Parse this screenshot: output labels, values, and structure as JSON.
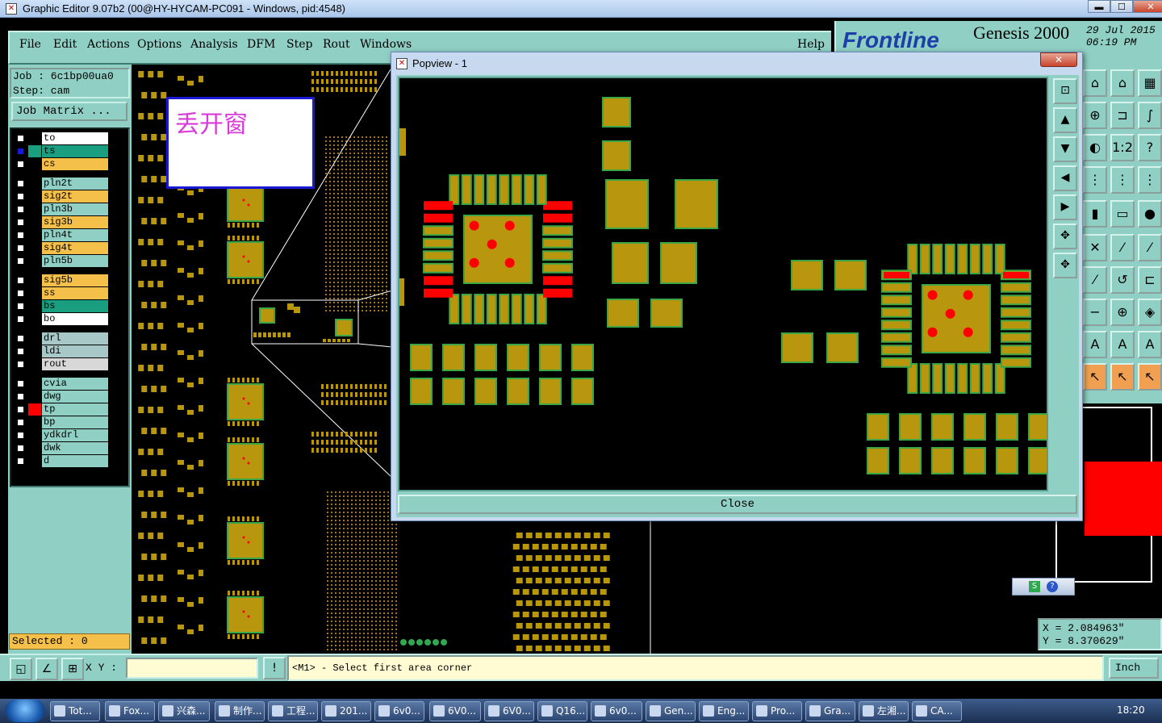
{
  "window": {
    "title": "Graphic Editor 9.07b2 (00@HY-HYCAM-PC091 - Windows, pid:4548)",
    "min": "▬",
    "max": "☐",
    "close": "✕"
  },
  "menu": {
    "items": [
      "File",
      "Edit",
      "Actions",
      "Options",
      "Analysis",
      "DFM",
      "Step",
      "Rout",
      "Windows"
    ],
    "help": "Help"
  },
  "brand": {
    "logo": "Frontline",
    "product": "Genesis 2000",
    "date": "29 Jul 2015",
    "time": "06:19 PM"
  },
  "job": {
    "job_line": "Job : 6c1bp00ua0",
    "step_line": "Step: cam",
    "matrix_button": "Job Matrix ..."
  },
  "layers": [
    {
      "name": "to",
      "color": "#ffffff",
      "swatch": "#000000",
      "checked": false
    },
    {
      "name": "ts",
      "color": "#1a9e80",
      "swatch": "#1a9e80",
      "checked": true
    },
    {
      "name": "cs",
      "color": "#f4c04a",
      "swatch": "#000000",
      "checked": false
    },
    {
      "name": "pln2t",
      "color": "#8fcfc4",
      "swatch": "#000000",
      "checked": false
    },
    {
      "name": "sig2t",
      "color": "#f4c04a",
      "swatch": "#000000",
      "checked": false
    },
    {
      "name": "pln3b",
      "color": "#8fcfc4",
      "swatch": "#000000",
      "checked": false
    },
    {
      "name": "sig3b",
      "color": "#f4c04a",
      "swatch": "#000000",
      "checked": false
    },
    {
      "name": "pln4t",
      "color": "#8fcfc4",
      "swatch": "#000000",
      "checked": false
    },
    {
      "name": "sig4t",
      "color": "#f4c04a",
      "swatch": "#000000",
      "checked": false
    },
    {
      "name": "pln5b",
      "color": "#8fcfc4",
      "swatch": "#000000",
      "checked": false
    },
    {
      "name": "sig5b",
      "color": "#f4c04a",
      "swatch": "#000000",
      "checked": false
    },
    {
      "name": "ss",
      "color": "#f4c04a",
      "swatch": "#000000",
      "checked": false
    },
    {
      "name": "bs",
      "color": "#1a9e80",
      "swatch": "#000000",
      "checked": false
    },
    {
      "name": "bo",
      "color": "#ffffff",
      "swatch": "#000000",
      "checked": false
    },
    {
      "name": "drl",
      "color": "#a8c8c8",
      "swatch": "#000000",
      "checked": false
    },
    {
      "name": "ldi",
      "color": "#a8c8c8",
      "swatch": "#000000",
      "checked": false
    },
    {
      "name": "rout",
      "color": "#d8d8d8",
      "swatch": "#000000",
      "checked": false
    },
    {
      "name": "cvia",
      "color": "#8fcfc4",
      "swatch": "#000000",
      "checked": false
    },
    {
      "name": "dwg",
      "color": "#8fcfc4",
      "swatch": "#000000",
      "checked": false
    },
    {
      "name": "tp",
      "color": "#8fcfc4",
      "swatch": "#ff0000",
      "checked": false
    },
    {
      "name": "bp",
      "color": "#8fcfc4",
      "swatch": "#000000",
      "checked": false
    },
    {
      "name": "ydkdrl",
      "color": "#8fcfc4",
      "swatch": "#000000",
      "checked": false
    },
    {
      "name": "dwk",
      "color": "#8fcfc4",
      "swatch": "#000000",
      "checked": false
    },
    {
      "name": "d",
      "color": "#8fcfc4",
      "swatch": "#000000",
      "checked": false
    }
  ],
  "selected": "Selected : 0",
  "annotation": "丢开窗",
  "popview": {
    "title": "Popview - 1",
    "close_button": "Close",
    "close_x": "✕"
  },
  "coords": {
    "x": "X = 2.084963\"",
    "y": "Y = 8.370629\""
  },
  "bottom": {
    "xy_label": "X Y :",
    "message": "<M1> - Select first area corner",
    "unit": "Inch"
  },
  "taskbar": {
    "items": [
      "Tot...",
      "Fox...",
      "兴森...",
      "制作...",
      "工程...",
      "201...",
      "6v0...",
      "6V0...",
      "6V0...",
      "Q16...",
      "6v0...",
      "Gen...",
      "Eng...",
      "Pro...",
      "Gra...",
      "左湘...",
      "CA..."
    ],
    "time": "18:20"
  },
  "colors": {
    "panel": "#8fcfc4",
    "pad": "#b8960e",
    "pad_border": "#3aa648",
    "smd_red": "#ff0000"
  }
}
